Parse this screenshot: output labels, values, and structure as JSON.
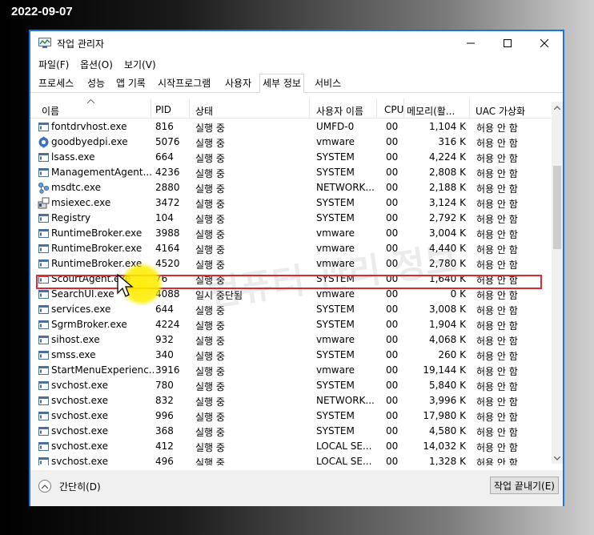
{
  "date_label": "2022-09-07",
  "window": {
    "title": "작업 관리자"
  },
  "menubar": [
    "파일(F)",
    "옵션(O)",
    "보기(V)"
  ],
  "tabs": [
    {
      "label": "프로세스",
      "active": false
    },
    {
      "label": "성능",
      "active": false
    },
    {
      "label": "앱 기록",
      "active": false
    },
    {
      "label": "시작프로그램",
      "active": false
    },
    {
      "label": "사용자",
      "active": false
    },
    {
      "label": "세부 정보",
      "active": true
    },
    {
      "label": "서비스",
      "active": false
    }
  ],
  "columns": {
    "name": "이름",
    "pid": "PID",
    "status": "상태",
    "user": "사용자 이름",
    "cpu": "CPU",
    "memory": "메모리(활...",
    "uac": "UAC 가상화"
  },
  "rows": [
    {
      "name": "fontdrvhost.exe",
      "pid": "816",
      "status": "실행 중",
      "user": "UMFD-0",
      "cpu": "00",
      "memory": "1,104 K",
      "uac": "허용 안 함",
      "icon": "exe-window-icon"
    },
    {
      "name": "goodbyedpi.exe",
      "pid": "5076",
      "status": "실행 중",
      "user": "vmware",
      "cpu": "00",
      "memory": "316 K",
      "uac": "허용 안 함",
      "icon": "gear-app-icon"
    },
    {
      "name": "lsass.exe",
      "pid": "664",
      "status": "실행 중",
      "user": "SYSTEM",
      "cpu": "00",
      "memory": "4,224 K",
      "uac": "허용 안 함",
      "icon": "exe-window-icon"
    },
    {
      "name": "ManagementAgent...",
      "pid": "4236",
      "status": "실행 중",
      "user": "SYSTEM",
      "cpu": "00",
      "memory": "2,808 K",
      "uac": "허용 안 함",
      "icon": "exe-window-icon"
    },
    {
      "name": "msdtc.exe",
      "pid": "2880",
      "status": "실행 중",
      "user": "NETWORK...",
      "cpu": "00",
      "memory": "2,188 K",
      "uac": "허용 안 함",
      "icon": "network-app-icon"
    },
    {
      "name": "msiexec.exe",
      "pid": "3472",
      "status": "실행 중",
      "user": "SYSTEM",
      "cpu": "00",
      "memory": "3,124 K",
      "uac": "허용 안 함",
      "icon": "installer-icon"
    },
    {
      "name": "Registry",
      "pid": "104",
      "status": "실행 중",
      "user": "SYSTEM",
      "cpu": "00",
      "memory": "2,792 K",
      "uac": "허용 안 함",
      "icon": "exe-window-icon"
    },
    {
      "name": "RuntimeBroker.exe",
      "pid": "3988",
      "status": "실행 중",
      "user": "vmware",
      "cpu": "00",
      "memory": "3,004 K",
      "uac": "허용 안 함",
      "icon": "exe-window-icon"
    },
    {
      "name": "RuntimeBroker.exe",
      "pid": "4164",
      "status": "실행 중",
      "user": "vmware",
      "cpu": "00",
      "memory": "4,440 K",
      "uac": "허용 안 함",
      "icon": "exe-window-icon"
    },
    {
      "name": "RuntimeBroker.exe",
      "pid": "4520",
      "status": "실행 중",
      "user": "vmware",
      "cpu": "00",
      "memory": "2,780 K",
      "uac": "허용 안 함",
      "icon": "exe-window-icon"
    },
    {
      "name": "ScourtAgent.exe",
      "pid": "76",
      "status": "실행 중",
      "user": "SYSTEM",
      "cpu": "00",
      "memory": "1,640 K",
      "uac": "허용 안 함",
      "icon": "exe-window-icon"
    },
    {
      "name": "SearchUI.exe",
      "pid": "4088",
      "status": "일시 중단됨",
      "user": "vmware",
      "cpu": "00",
      "memory": "0 K",
      "uac": "허용 안 함",
      "icon": "exe-window-icon"
    },
    {
      "name": "services.exe",
      "pid": "644",
      "status": "실행 중",
      "user": "SYSTEM",
      "cpu": "00",
      "memory": "3,008 K",
      "uac": "허용 안 함",
      "icon": "exe-window-icon"
    },
    {
      "name": "SgrmBroker.exe",
      "pid": "4224",
      "status": "실행 중",
      "user": "SYSTEM",
      "cpu": "00",
      "memory": "1,904 K",
      "uac": "허용 안 함",
      "icon": "exe-window-icon"
    },
    {
      "name": "sihost.exe",
      "pid": "932",
      "status": "실행 중",
      "user": "vmware",
      "cpu": "00",
      "memory": "4,068 K",
      "uac": "허용 안 함",
      "icon": "exe-window-icon"
    },
    {
      "name": "smss.exe",
      "pid": "340",
      "status": "실행 중",
      "user": "SYSTEM",
      "cpu": "00",
      "memory": "260 K",
      "uac": "허용 안 함",
      "icon": "exe-window-icon"
    },
    {
      "name": "StartMenuExperienc...",
      "pid": "3916",
      "status": "실행 중",
      "user": "vmware",
      "cpu": "00",
      "memory": "19,144 K",
      "uac": "허용 안 함",
      "icon": "exe-window-icon"
    },
    {
      "name": "svchost.exe",
      "pid": "780",
      "status": "실행 중",
      "user": "SYSTEM",
      "cpu": "00",
      "memory": "5,840 K",
      "uac": "허용 안 함",
      "icon": "exe-window-icon"
    },
    {
      "name": "svchost.exe",
      "pid": "832",
      "status": "실행 중",
      "user": "NETWORK...",
      "cpu": "00",
      "memory": "3,996 K",
      "uac": "허용 안 함",
      "icon": "exe-window-icon"
    },
    {
      "name": "svchost.exe",
      "pid": "996",
      "status": "실행 중",
      "user": "SYSTEM",
      "cpu": "00",
      "memory": "17,980 K",
      "uac": "허용 안 함",
      "icon": "exe-window-icon"
    },
    {
      "name": "svchost.exe",
      "pid": "368",
      "status": "실행 중",
      "user": "SYSTEM",
      "cpu": "00",
      "memory": "4,580 K",
      "uac": "허용 안 함",
      "icon": "exe-window-icon"
    },
    {
      "name": "svchost.exe",
      "pid": "412",
      "status": "실행 중",
      "user": "LOCAL SE...",
      "cpu": "00",
      "memory": "14,032 K",
      "uac": "허용 안 함",
      "icon": "exe-window-icon"
    },
    {
      "name": "svchost.exe",
      "pid": "496",
      "status": "실행 중",
      "user": "LOCAL SE...",
      "cpu": "00",
      "memory": "1,328 K",
      "uac": "허용 안 함",
      "icon": "exe-window-icon"
    }
  ],
  "highlighted_row": "ScourtAgent.exe",
  "footer": {
    "collapse_label": "간단히(D)",
    "end_task_label": "작업 끝내기(E)"
  },
  "watermark": "컴퓨터 관리 정보",
  "colors": {
    "window_border": "#1e73d8",
    "highlight": "#e0262f",
    "cursor_glow": "#ffec00"
  }
}
